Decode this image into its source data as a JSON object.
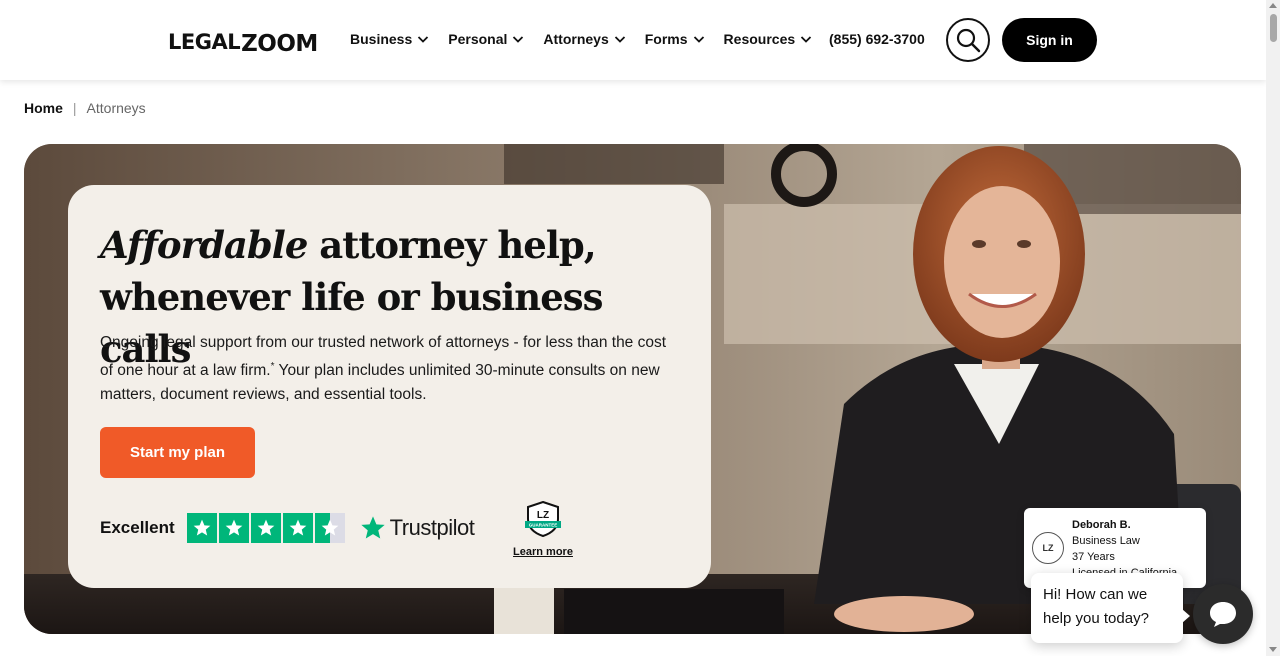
{
  "header": {
    "logo": {
      "part1": "LEGAL",
      "part2": "ZOOM"
    },
    "nav": [
      {
        "label": "Business"
      },
      {
        "label": "Personal"
      },
      {
        "label": "Attorneys"
      },
      {
        "label": "Forms"
      },
      {
        "label": "Resources"
      }
    ],
    "phone": "(855) 692-3700",
    "signin_label": "Sign in"
  },
  "breadcrumb": {
    "home": "Home",
    "separator": "|",
    "current": "Attorneys"
  },
  "hero": {
    "headline_emphasis": "Affordable",
    "headline_rest": " attorney help, whenever life or business calls",
    "body_before": "Ongoing legal support from our trusted network of attorneys - for less than the cost of one hour at a law firm.",
    "body_sup": "*",
    "body_after": " Your plan includes unlimited 30-minute consults on new matters, document reviews, and essential tools.",
    "cta_label": "Start my plan",
    "rating_label": "Excellent",
    "rating_stars": 4.5,
    "trustpilot_label": "Trustpilot",
    "guarantee_badge": "LZ",
    "guarantee_text": "GUARANTEE",
    "learn_more": "Learn more"
  },
  "attorney": {
    "badge": "LZ",
    "name": "Deborah B.",
    "practice": "Business Law",
    "years": "37 Years",
    "license": "Licensed in California"
  },
  "chat": {
    "message": "Hi! How can we help you today?"
  },
  "colors": {
    "accent": "#f05a28",
    "trustpilot_green": "#00b67a",
    "card_bg": "#f3efe9"
  }
}
